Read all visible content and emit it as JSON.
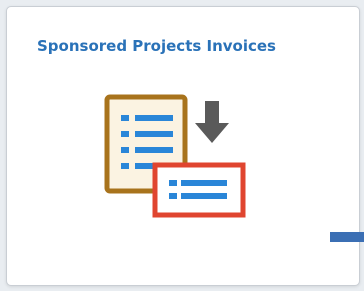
{
  "tile": {
    "title": "Sponsored Projects Invoices",
    "icon": "invoice-download-icon"
  },
  "colors": {
    "title": "#2a72b8",
    "document_border": "#a8731c",
    "document_fill": "#fbf3e2",
    "list_lines": "#2a86d8",
    "arrow": "#5a5a5a",
    "card_border": "#e0452f",
    "indicator": "#3b6fb4"
  }
}
